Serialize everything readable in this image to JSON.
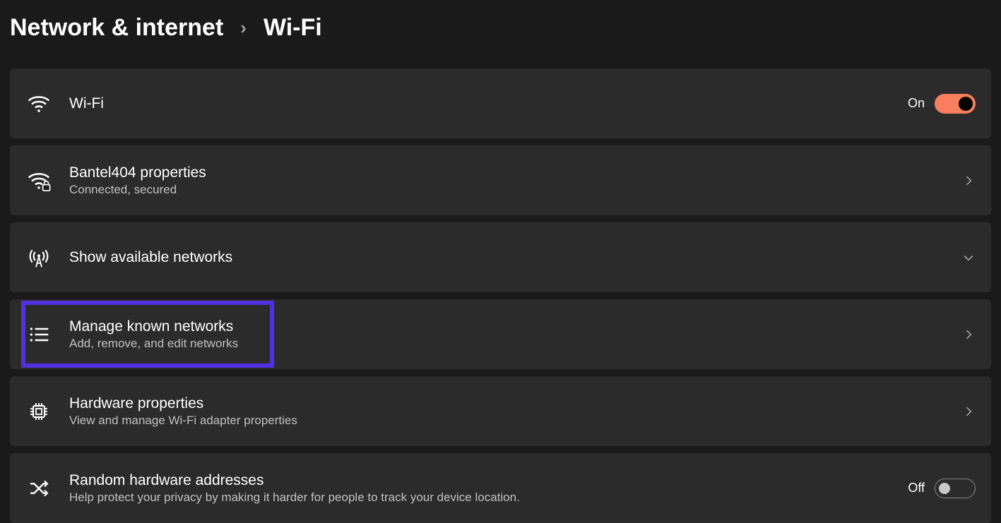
{
  "breadcrumb": {
    "parent": "Network & internet",
    "separator": "›",
    "current": "Wi-Fi"
  },
  "rows": {
    "wifi": {
      "title": "Wi-Fi",
      "toggle_label": "On"
    },
    "network_props": {
      "title": "Bantel404 properties",
      "sub": "Connected, secured"
    },
    "available": {
      "title": "Show available networks"
    },
    "manage": {
      "title": "Manage known networks",
      "sub": "Add, remove, and edit networks"
    },
    "hardware": {
      "title": "Hardware properties",
      "sub": "View and manage Wi-Fi adapter properties"
    },
    "random": {
      "title": "Random hardware addresses",
      "sub": "Help protect your privacy by making it harder for people to track your device location.",
      "toggle_label": "Off"
    }
  }
}
